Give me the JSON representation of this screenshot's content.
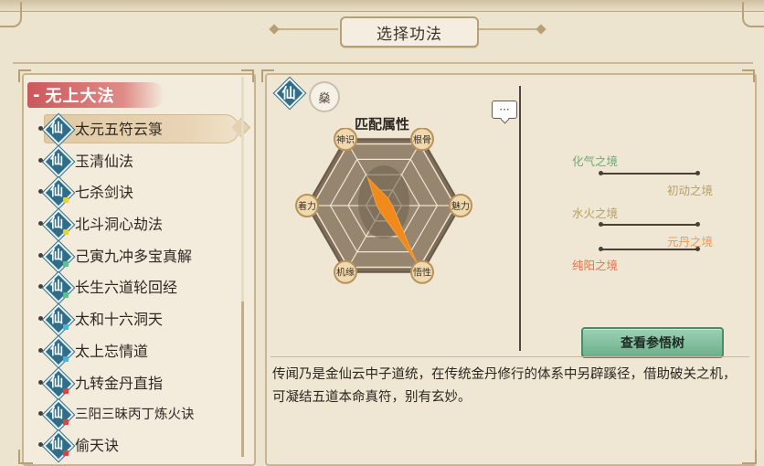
{
  "window": {
    "title": "选择功法"
  },
  "category": {
    "dash": "-",
    "name": "无上大法"
  },
  "badge_char": "仙",
  "skills": [
    {
      "name": "太元五符云箓",
      "selected": true
    },
    {
      "name": "玉清仙法"
    },
    {
      "name": "七杀剑诀",
      "dot_color": "#e8d23a"
    },
    {
      "name": "北斗洞心劫法",
      "dot_color": "#e8d23a"
    },
    {
      "name": "己寅九冲多宝真解",
      "dot_color": "#5bc28c"
    },
    {
      "name": "长生六道轮回经",
      "dot_color": "#5bc28c"
    },
    {
      "name": "太和十六洞天",
      "dot_color": "#4db3d6"
    },
    {
      "name": "太上忘情道",
      "dot_color": "#4db3d6"
    },
    {
      "name": "九转金丹直指",
      "dot_color": "#d9453f"
    },
    {
      "name": "三阳三昧丙丁炼火诀",
      "dot_color": "#d9453f"
    },
    {
      "name": "偷天诀",
      "dot_color": "#d9453f"
    }
  ],
  "detail": {
    "badge_char": "仙",
    "pin_char": "燊",
    "chat_icon": "···",
    "attributes_title": "匹配属性",
    "attributes": {
      "labels": [
        "神识",
        "根骨",
        "魅力",
        "悟性",
        "机缘",
        "着力"
      ],
      "values": [
        0.45,
        0.12,
        0.12,
        0.92,
        0.1,
        0.1
      ],
      "fill_color": "#f08a1c"
    },
    "stages": [
      {
        "name": "化气之境",
        "color": "#6fa86f"
      },
      {
        "name": "初动之境",
        "color": "#b3a066"
      },
      {
        "name": "水火之境",
        "color": "#b3a066"
      },
      {
        "name": "元丹之境",
        "color": "#e89a55"
      },
      {
        "name": "纯阳之境",
        "color": "#e8704a"
      }
    ],
    "tree_button": "查看参悟树",
    "description": "传闻乃是金仙云中子道统，在传统金丹修行的体系中另辟蹊径，借助破关之机，可凝结五道本命真符，别有玄妙。"
  }
}
